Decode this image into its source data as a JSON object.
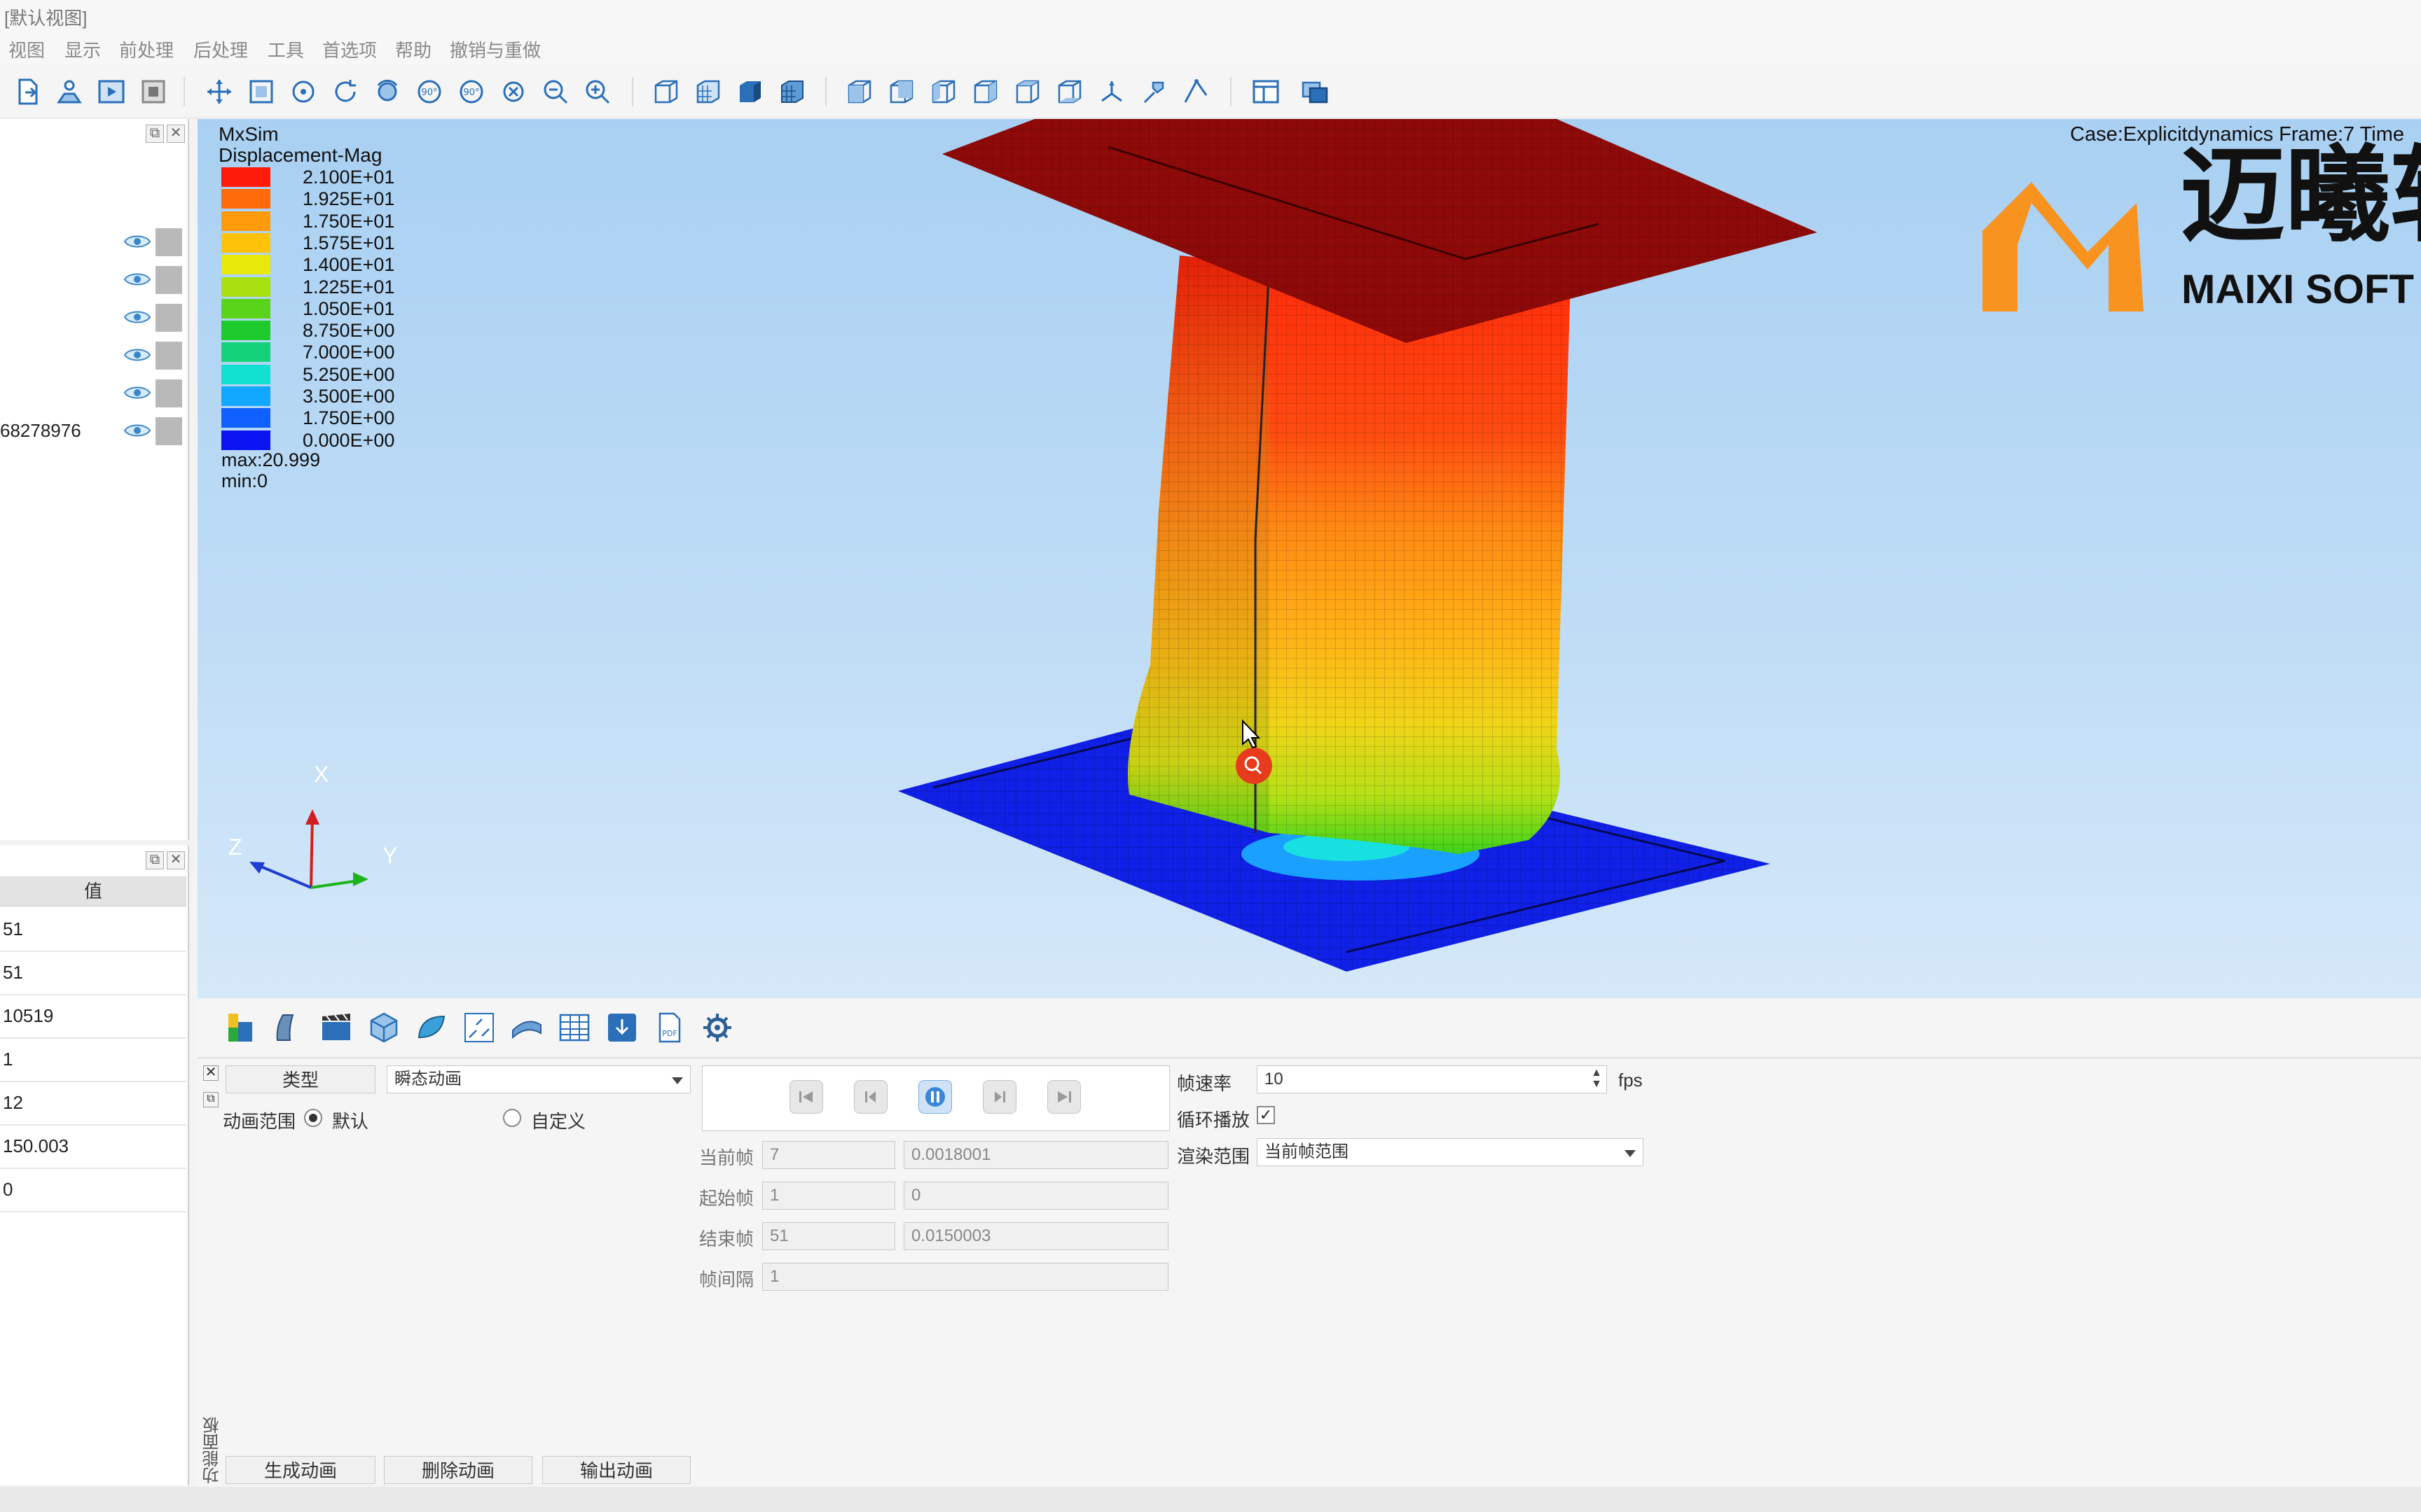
{
  "window": {
    "title": "[默认视图]"
  },
  "menu": [
    "视图",
    "显示",
    "前处理",
    "后处理",
    "工具",
    "首选项",
    "帮助",
    "撤销与重做"
  ],
  "model_tree": {
    "items": [
      {
        "label": ""
      },
      {
        "label": ""
      },
      {
        "label": ""
      },
      {
        "label": ""
      },
      {
        "label": ""
      },
      {
        "label": "68278976"
      }
    ]
  },
  "properties": {
    "header": "值",
    "rows": [
      "51",
      "51",
      "10519",
      "1",
      "12",
      "150.003",
      "0"
    ]
  },
  "viewport": {
    "solver_name": "MxSim",
    "result_name": "Displacement-Mag",
    "legend": [
      {
        "value": "2.100E+01",
        "color": "#ff1a0a"
      },
      {
        "value": "1.925E+01",
        "color": "#ff6a0a"
      },
      {
        "value": "1.750E+01",
        "color": "#ff9a0a"
      },
      {
        "value": "1.575E+01",
        "color": "#ffc20a"
      },
      {
        "value": "1.400E+01",
        "color": "#e8e80a"
      },
      {
        "value": "1.225E+01",
        "color": "#a8e010"
      },
      {
        "value": "1.050E+01",
        "color": "#5ad41a"
      },
      {
        "value": "8.750E+00",
        "color": "#1ecb2c"
      },
      {
        "value": "7.000E+00",
        "color": "#14d27a"
      },
      {
        "value": "5.250E+00",
        "color": "#12e0d0"
      },
      {
        "value": "3.500E+00",
        "color": "#12a8ff"
      },
      {
        "value": "1.750E+00",
        "color": "#1060ff"
      },
      {
        "value": "0.000E+00",
        "color": "#0a14f0"
      }
    ],
    "max": "max:20.999",
    "min": "min:0",
    "case_info": "Case:Explicitdynamics Frame:7 Time",
    "axes": {
      "x": "X",
      "y": "Y",
      "z": "Z"
    },
    "logo": {
      "cn": "迈曦软",
      "en": "MAIXI SOFT",
      "color": "#f7931e"
    }
  },
  "animation": {
    "type_label": "类型",
    "type_value": "瞬态动画",
    "range_label": "动画范围",
    "range_default": "默认",
    "range_custom": "自定义",
    "current_frame_label": "当前帧",
    "current_frame": "7",
    "current_time": "0.0018001",
    "start_frame_label": "起始帧",
    "start_frame": "1",
    "start_time": "0",
    "end_frame_label": "结束帧",
    "end_frame": "51",
    "end_time": "0.0150003",
    "interval_label": "帧间隔",
    "interval": "1",
    "fps_label": "帧速率",
    "fps_value": "10",
    "fps_unit": "fps",
    "loop_label": "循环播放",
    "loop_checked": "✓",
    "render_range_label": "渲染范围",
    "render_range_value": "当前帧范围",
    "generate_button": "生成动画",
    "delete_button": "删除动画",
    "export_button": "输出动画",
    "panel_label": "功能面板"
  }
}
